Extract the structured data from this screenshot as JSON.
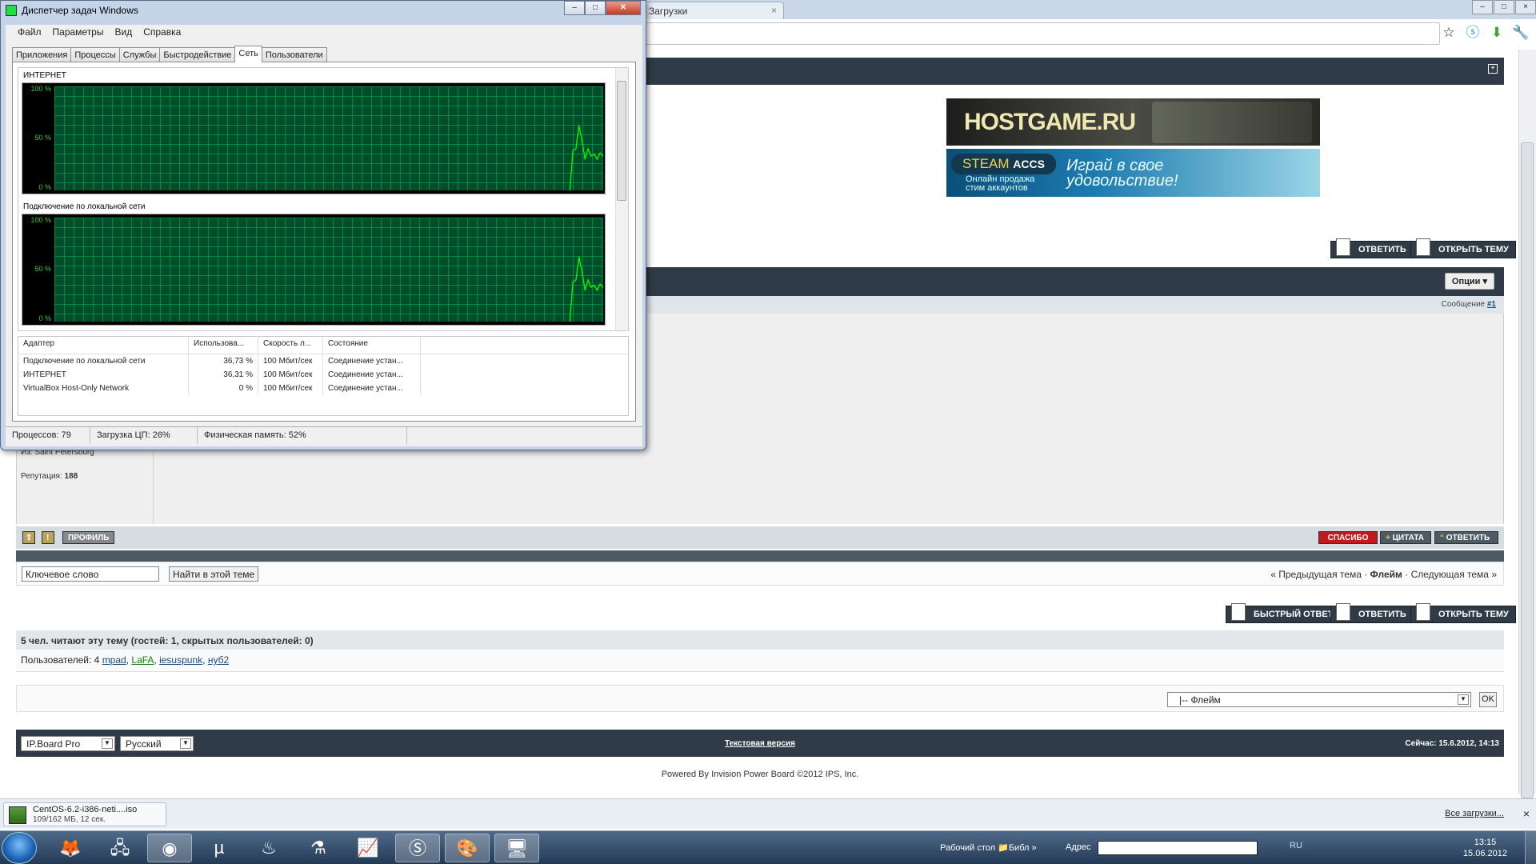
{
  "chrome": {
    "tabs": [
      {
        "label": "Загрузки",
        "close": "×"
      }
    ],
    "window_controls": [
      "–",
      "□",
      "×"
    ]
  },
  "forum": {
    "options_label": "Опции ▾",
    "post_label": "Сообщение",
    "post_number": "#1",
    "reply_label": "ОТВЕТИТЬ",
    "open_topic_label": "ОТКРЫТЬ ТЕМУ",
    "quick_reply_label": "БЫСТРЫЙ ОТВЕТ",
    "banner1": "HOSTGAME.RU",
    "banner2_brand": "STEAM",
    "banner2_brand_small": "ACCS",
    "banner2_sub1": "Онлайн продажа",
    "banner2_sub2": "стим аккаунтов",
    "banner2_slogan1": "Играй в свое",
    "banner2_slogan2": "удовольствие!",
    "from_label": "Из: Saint Petersburg",
    "rep_label": "Репутация:",
    "rep_value": "188",
    "profile_btn": "ПРОФИЛЬ",
    "thanks_btn": "СПАСИБО",
    "quote_btn": "ЦИТАТА",
    "reply_small_btn": "ОТВЕТИТЬ",
    "keyword_value": "Ключевое слово",
    "find_btn": "Найти в этой теме",
    "prev_topic": "« Предыдущая тема ·",
    "forum_name": "Флейм",
    "next_topic": "· Следующая тема »",
    "readers_title": "5 чел. читают эту тему (гостей: 1, скрытых пользователей: 0)",
    "users_prefix": "Пользователей: 4",
    "users": [
      "mpad",
      "LaFA",
      "iesuspunk",
      "нуб2"
    ],
    "jump_value": "|-- Флейм",
    "jump_ok": "OK",
    "skin_select": "IP.Board Pro",
    "lang_select": "Русский",
    "text_version": "Текстовая версия",
    "now_text": "Сейчас: 15.6.2012, 14:13",
    "powered": "Powered By Invision Power Board  ©2012  IPS, Inc."
  },
  "downloads": {
    "file_name": "CentOS-6.2-i386-neti....iso",
    "file_progress": "109/162 МБ, 12 сек.",
    "all_downloads": "Все загрузки...",
    "close": "×"
  },
  "taskbar": {
    "desktop_label": "Рабочий стол",
    "lib_label": "Библ",
    "address_label": "Адрес",
    "lang": "RU",
    "time": "13:15",
    "date": "15.06.2012"
  },
  "taskmgr": {
    "title": "Диспетчер задач Windows",
    "menu": [
      "Файл",
      "Параметры",
      "Вид",
      "Справка"
    ],
    "tabs": [
      "Приложения",
      "Процессы",
      "Службы",
      "Быстродействие",
      "Сеть",
      "Пользователи"
    ],
    "active_tab": "Сеть",
    "graph1_title": "ИНТЕРНЕТ",
    "graph2_title": "Подключение по локальной сети",
    "y_labels": [
      "100 %",
      "50 %",
      "0 %"
    ],
    "columns": [
      "Адаптер",
      "Использова...",
      "Скорость л...",
      "Состояние"
    ],
    "rows": [
      [
        "Подключение по локальной сети",
        "36,73 %",
        "100 Мбит/сек",
        "Соединение устан..."
      ],
      [
        "ИНТЕРНЕТ",
        "36,31 %",
        "100 Мбит/сек",
        "Соединение устан..."
      ],
      [
        "VirtualBox Host-Only Network",
        "0 %",
        "100 Мбит/сек",
        "Соединение устан..."
      ]
    ],
    "status_processes": "Процессов: 79",
    "status_cpu": "Загрузка ЦП: 26%",
    "status_mem": "Физическая память: 52%"
  },
  "colors": {
    "forum_dark": "#2f3b46",
    "graph_line": "#00ff00",
    "graph_grid": "#008a40",
    "thanks_red": "#c0191e"
  },
  "chart_data": [
    {
      "type": "line",
      "title": "ИНТЕРНЕТ",
      "ylim": [
        0,
        100
      ],
      "yticks": [
        "0 %",
        "50 %",
        "100 %"
      ],
      "x": [
        0,
        1,
        2,
        3,
        4,
        5,
        6,
        7,
        8,
        9,
        10,
        11,
        12,
        13,
        14,
        15,
        16,
        17,
        18,
        19,
        20,
        21,
        22,
        23,
        24,
        25,
        26,
        27,
        28,
        29
      ],
      "values": [
        0,
        0,
        0,
        0,
        0,
        0,
        0,
        0,
        0,
        0,
        0,
        0,
        0,
        0,
        0,
        0,
        0,
        0,
        0,
        38,
        40,
        62,
        48,
        30,
        40,
        33,
        35,
        30,
        36,
        33
      ]
    },
    {
      "type": "line",
      "title": "Подключение по локальной сети",
      "ylim": [
        0,
        100
      ],
      "yticks": [
        "0 %",
        "50 %",
        "100 %"
      ],
      "x": [
        0,
        1,
        2,
        3,
        4,
        5,
        6,
        7,
        8,
        9,
        10,
        11,
        12,
        13,
        14,
        15,
        16,
        17,
        18,
        19,
        20,
        21,
        22,
        23,
        24,
        25,
        26,
        27,
        28,
        29
      ],
      "values": [
        0,
        0,
        0,
        0,
        0,
        0,
        0,
        0,
        0,
        0,
        0,
        0,
        0,
        0,
        0,
        0,
        0,
        0,
        0,
        38,
        40,
        62,
        48,
        30,
        40,
        33,
        35,
        30,
        36,
        33
      ]
    }
  ]
}
